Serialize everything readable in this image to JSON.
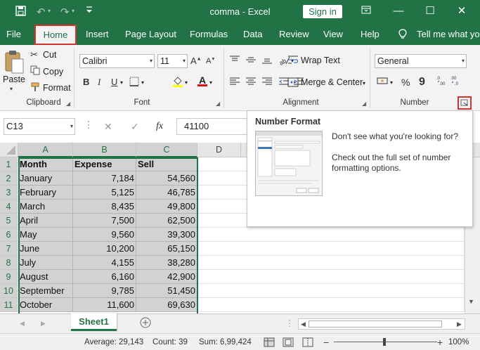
{
  "titlebar": {
    "title": "comma  -  Excel",
    "sign_in": "Sign in"
  },
  "tabs": [
    "File",
    "Home",
    "Insert",
    "Page Layout",
    "Formulas",
    "Data",
    "Review",
    "View",
    "Help"
  ],
  "tell_me": "Tell me what yo",
  "ribbon": {
    "clipboard": {
      "paste": "Paste",
      "cut": "Cut",
      "copy": "Copy",
      "format": "Format",
      "label": "Clipboard"
    },
    "font": {
      "name": "Calibri",
      "size": "11",
      "label": "Font"
    },
    "alignment": {
      "wrap_text": "Wrap Text",
      "merge_center": "Merge & Center",
      "label": "Alignment"
    },
    "number": {
      "format": "General",
      "label": "Number"
    }
  },
  "formula_bar": {
    "name_box": "C13",
    "fx": "fx",
    "value": "41100"
  },
  "columns": [
    "A",
    "B",
    "C",
    "D"
  ],
  "table": {
    "headers": [
      "Month",
      "Expense",
      "Sell"
    ],
    "rows": [
      [
        "January",
        "7,184",
        "54,560"
      ],
      [
        "February",
        "5,125",
        "46,785"
      ],
      [
        "March",
        "8,435",
        "49,800"
      ],
      [
        "April",
        "7,500",
        "62,500"
      ],
      [
        "May",
        "9,560",
        "39,300"
      ],
      [
        "June",
        "10,200",
        "65,150"
      ],
      [
        "July",
        "4,155",
        "38,280"
      ],
      [
        "August",
        "6,160",
        "42,900"
      ],
      [
        "September",
        "9,785",
        "51,450"
      ],
      [
        "October",
        "11,600",
        "69,630"
      ]
    ],
    "row_numbers": [
      "1",
      "2",
      "3",
      "4",
      "5",
      "6",
      "7",
      "8",
      "9",
      "10",
      "11"
    ]
  },
  "tooltip": {
    "title": "Number Format",
    "line1": "Don't see what you're looking for?",
    "line2": "Check out the full set of number formatting options."
  },
  "sheet": {
    "tab": "Sheet1"
  },
  "status": {
    "average": "Average: 29,143",
    "count": "Count: 39",
    "sum": "Sum: 6,99,424",
    "zoom": "100%"
  },
  "colors": {
    "brand": "#217346",
    "highlight_border": "#d93030",
    "selection": "#d2d2d2"
  }
}
